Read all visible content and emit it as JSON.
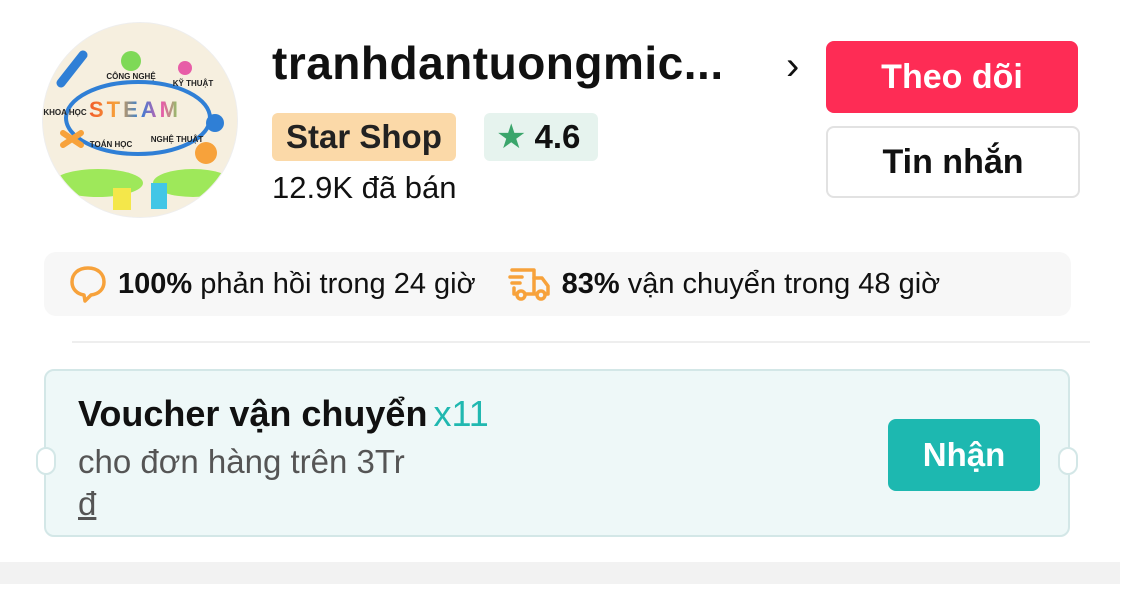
{
  "shop": {
    "name": "tranhdantuongmic...",
    "badge": "Star Shop",
    "rating": "4.6",
    "sold": "12.9K đã bán",
    "avatar_lettering": [
      "STEAM",
      "CÔNG NGHỆ",
      "KỸ THUẬT",
      "KHOA HỌC",
      "TOÁN HỌC",
      "NGHỆ THUẬT"
    ]
  },
  "actions": {
    "follow_label": "Theo dõi",
    "message_label": "Tin nhắn"
  },
  "stats": [
    {
      "icon": "chat-bubble-icon",
      "value": "100%",
      "text": "phản hồi trong 24 giờ"
    },
    {
      "icon": "delivery-truck-icon",
      "value": "83%",
      "text": "vận chuyển trong 48 giờ"
    }
  ],
  "voucher": {
    "title": "Voucher vận chuyển",
    "count": "x11",
    "subtitle": "cho đơn hàng trên 3Tr",
    "currency": "đ",
    "claim_label": "Nhận"
  },
  "colors": {
    "accent": "#fe2c55",
    "teal": "#1db8b0",
    "orange": "#f7a23b"
  }
}
